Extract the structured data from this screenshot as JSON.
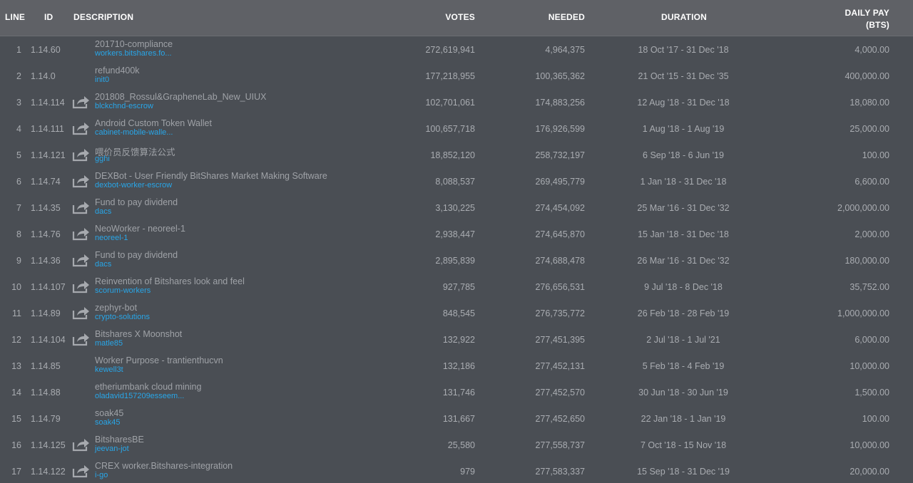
{
  "columns": {
    "line": "LINE",
    "id": "ID",
    "description": "DESCRIPTION",
    "votes": "VOTES",
    "needed": "NEEDED",
    "duration": "DURATION",
    "daily_pay": "DAILY PAY",
    "daily_pay_unit": "(BTS)"
  },
  "colors": {
    "background": "#4a4e54",
    "header": "#5f6166",
    "link": "#28a6e8",
    "text": "#a9acb1"
  },
  "rows": [
    {
      "line": "1",
      "id": "1.14.60",
      "icon": false,
      "title": "201710-compliance",
      "owner": "workers.bitshares.fo...",
      "votes": "272,619,941",
      "needed": "4,964,375",
      "duration": "18 Oct '17 - 31 Dec '18",
      "pay": "4,000.00"
    },
    {
      "line": "2",
      "id": "1.14.0",
      "icon": false,
      "title": "refund400k",
      "owner": "init0",
      "votes": "177,218,955",
      "needed": "100,365,362",
      "duration": "21 Oct '15 - 31 Dec '35",
      "pay": "400,000.00"
    },
    {
      "line": "3",
      "id": "1.14.114",
      "icon": true,
      "title": "201808_Rossul&GrapheneLab_New_UIUX",
      "owner": "blckchnd-escrow",
      "votes": "102,701,061",
      "needed": "174,883,256",
      "duration": "12 Aug '18 - 31 Dec '18",
      "pay": "18,080.00"
    },
    {
      "line": "4",
      "id": "1.14.111",
      "icon": true,
      "title": "Android Custom Token Wallet",
      "owner": "cabinet-mobile-walle...",
      "votes": "100,657,718",
      "needed": "176,926,599",
      "duration": "1 Aug '18 - 1 Aug '19",
      "pay": "25,000.00"
    },
    {
      "line": "5",
      "id": "1.14.121",
      "icon": true,
      "title": "喂价员反馈算法公式",
      "owner": "gghi",
      "votes": "18,852,120",
      "needed": "258,732,197",
      "duration": "6 Sep '18 - 6 Jun '19",
      "pay": "100.00"
    },
    {
      "line": "6",
      "id": "1.14.74",
      "icon": true,
      "title": "DEXBot - User Friendly BitShares Market Making Software",
      "owner": "dexbot-worker-escrow",
      "votes": "8,088,537",
      "needed": "269,495,779",
      "duration": "1 Jan '18 - 31 Dec '18",
      "pay": "6,600.00"
    },
    {
      "line": "7",
      "id": "1.14.35",
      "icon": true,
      "title": "Fund to pay dividend",
      "owner": "dacs",
      "votes": "3,130,225",
      "needed": "274,454,092",
      "duration": "25 Mar '16 - 31 Dec '32",
      "pay": "2,000,000.00"
    },
    {
      "line": "8",
      "id": "1.14.76",
      "icon": true,
      "title": "NeoWorker - neoreel-1",
      "owner": "neoreel-1",
      "votes": "2,938,447",
      "needed": "274,645,870",
      "duration": "15 Jan '18 - 31 Dec '18",
      "pay": "2,000.00"
    },
    {
      "line": "9",
      "id": "1.14.36",
      "icon": true,
      "title": "Fund to pay dividend",
      "owner": "dacs",
      "votes": "2,895,839",
      "needed": "274,688,478",
      "duration": "26 Mar '16 - 31 Dec '32",
      "pay": "180,000.00"
    },
    {
      "line": "10",
      "id": "1.14.107",
      "icon": true,
      "title": "Reinvention of Bitshares look and feel",
      "owner": "scorum-workers",
      "votes": "927,785",
      "needed": "276,656,531",
      "duration": "9 Jul '18 - 8 Dec '18",
      "pay": "35,752.00"
    },
    {
      "line": "11",
      "id": "1.14.89",
      "icon": true,
      "title": "zephyr-bot",
      "owner": "crypto-solutions",
      "votes": "848,545",
      "needed": "276,735,772",
      "duration": "26 Feb '18 - 28 Feb '19",
      "pay": "1,000,000.00"
    },
    {
      "line": "12",
      "id": "1.14.104",
      "icon": true,
      "title": "Bitshares X Moonshot",
      "owner": "matle85",
      "votes": "132,922",
      "needed": "277,451,395",
      "duration": "2 Jul '18 - 1 Jul '21",
      "pay": "6,000.00"
    },
    {
      "line": "13",
      "id": "1.14.85",
      "icon": false,
      "title": "Worker Purpose - trantienthucvn",
      "owner": "kewell3t",
      "votes": "132,186",
      "needed": "277,452,131",
      "duration": "5 Feb '18 - 4 Feb '19",
      "pay": "10,000.00"
    },
    {
      "line": "14",
      "id": "1.14.88",
      "icon": false,
      "title": "etheriumbank cloud mining",
      "owner": "oladavid157209esseem...",
      "votes": "131,746",
      "needed": "277,452,570",
      "duration": "30 Jun '18 - 30 Jun '19",
      "pay": "1,500.00"
    },
    {
      "line": "15",
      "id": "1.14.79",
      "icon": false,
      "title": "soak45",
      "owner": "soak45",
      "votes": "131,667",
      "needed": "277,452,650",
      "duration": "22 Jan '18 - 1 Jan '19",
      "pay": "100.00"
    },
    {
      "line": "16",
      "id": "1.14.125",
      "icon": true,
      "title": "BitsharesBE",
      "owner": "jeevan-jot",
      "votes": "25,580",
      "needed": "277,558,737",
      "duration": "7 Oct '18 - 15 Nov '18",
      "pay": "10,000.00"
    },
    {
      "line": "17",
      "id": "1.14.122",
      "icon": true,
      "title": "CREX worker.Bitshares-integration",
      "owner": "i-go",
      "votes": "979",
      "needed": "277,583,337",
      "duration": "15 Sep '18 - 31 Dec '19",
      "pay": "20,000.00"
    }
  ]
}
